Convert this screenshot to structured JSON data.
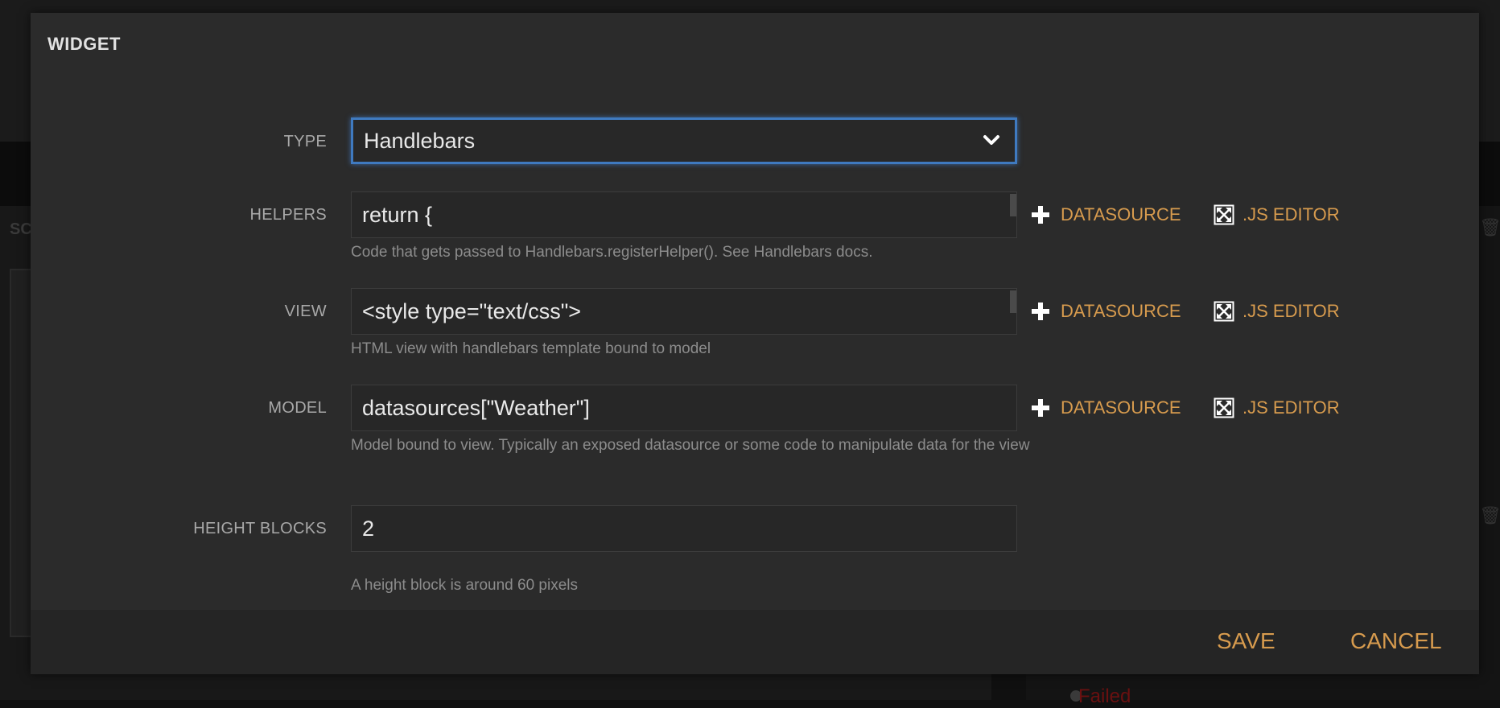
{
  "background": {
    "left_label": "SC",
    "status_text": "Failed"
  },
  "modal": {
    "title": "WIDGET",
    "fields": {
      "type": {
        "label": "TYPE",
        "value": "Handlebars"
      },
      "helpers": {
        "label": "HELPERS",
        "value": "return {",
        "help": "Code that gets passed to Handlebars.registerHelper(). See Handlebars docs."
      },
      "view": {
        "label": "VIEW",
        "value": "<style type=\"text/css\">",
        "help": "HTML view with handlebars template bound to model"
      },
      "model": {
        "label": "MODEL",
        "value": "datasources[\"Weather\"]",
        "help": "Model bound to view. Typically an exposed datasource or some code to manipulate data for the view"
      },
      "height_blocks": {
        "label": "HEIGHT BLOCKS",
        "value": "2",
        "help": "A height block is around 60 pixels"
      }
    },
    "actions": {
      "datasource_label": "DATASOURCE",
      "js_editor_label": ".JS EDITOR"
    },
    "footer": {
      "save_label": "SAVE",
      "cancel_label": "CANCEL"
    }
  },
  "colors": {
    "accent": "#d79b4e",
    "focus": "#3f7ac0",
    "modal_bg": "#2b2b2b",
    "field_bg": "#272727"
  }
}
